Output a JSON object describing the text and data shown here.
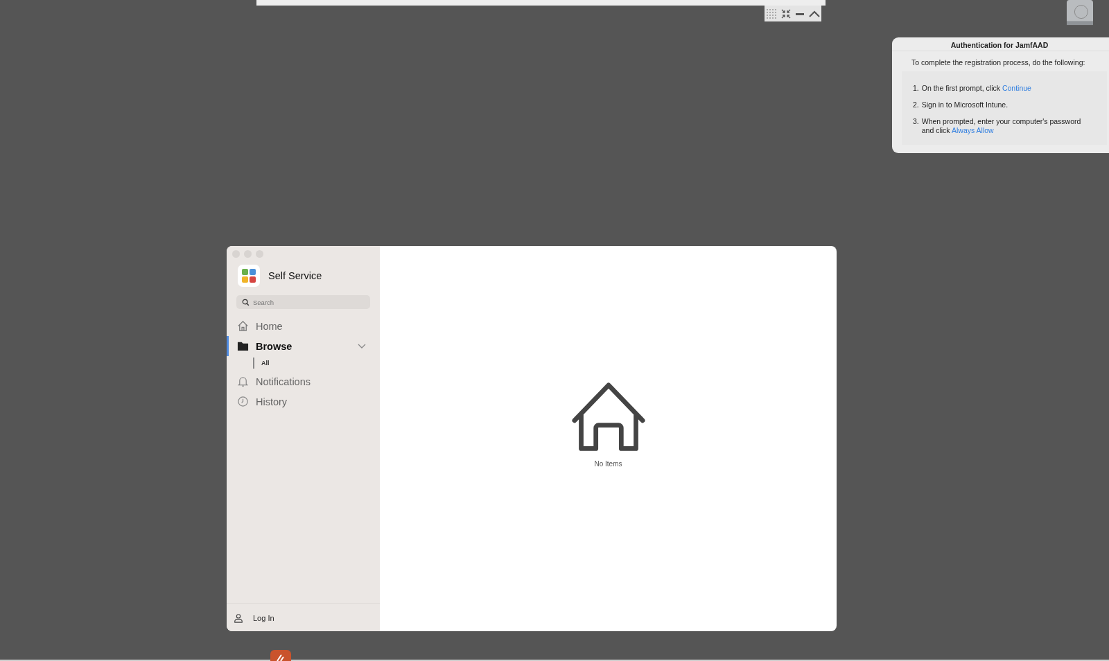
{
  "app_window": {
    "title": "Self Service",
    "search": {
      "placeholder": "Search"
    },
    "nav": [
      {
        "label": "Home",
        "kind": "home",
        "selected": false
      },
      {
        "label": "Browse",
        "kind": "folder",
        "selected": true,
        "expanded": true,
        "children": [
          {
            "label": "All",
            "selected": false
          }
        ]
      },
      {
        "label": "Notifications",
        "kind": "bell",
        "selected": false
      },
      {
        "label": "History",
        "kind": "clock",
        "selected": false
      }
    ],
    "footer": {
      "label": "Log In"
    },
    "empty_state": {
      "label": "No Items"
    }
  },
  "notification": {
    "title": "Authentication for JamfAAD",
    "intro": "To complete the registration process, do the following:",
    "steps": [
      {
        "number": "1.",
        "text": "On the first prompt, click",
        "link": "Continue"
      },
      {
        "number": "2.",
        "text": "Sign in to Microsoft Intune."
      },
      {
        "number": "3.",
        "text": "When prompted, enter your computer's password and click",
        "link": "Always Allow"
      }
    ]
  }
}
